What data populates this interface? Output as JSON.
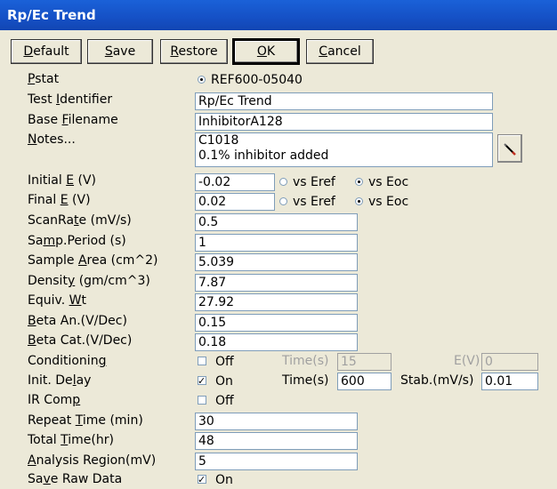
{
  "window": {
    "title": "Rp/Ec Trend"
  },
  "toolbar": {
    "default": {
      "u": "D",
      "rest": "efault"
    },
    "save": {
      "u": "S",
      "rest": "ave"
    },
    "restore": {
      "u": "R",
      "rest": "estore"
    },
    "ok": {
      "u": "O",
      "rest": "K"
    },
    "cancel": {
      "u": "C",
      "rest": "ancel"
    }
  },
  "pstat": {
    "pre": "",
    "u": "P",
    "post": "stat",
    "value": "REF600-05040"
  },
  "test_identifier": {
    "pre": "Test ",
    "u": "I",
    "post": "dentifier",
    "value": "Rp/Ec Trend"
  },
  "base_filename": {
    "pre": "Base ",
    "u": "F",
    "post": "ilename",
    "value": "InhibitorA128"
  },
  "notes": {
    "pre": "",
    "u": "N",
    "post": "otes...",
    "line1": "C1018",
    "line2": "0.1% inhibitor added"
  },
  "initial_e": {
    "pre": "Initial ",
    "u": "E",
    "post": " (V)",
    "value": "-0.02",
    "opt1": "vs Eref",
    "opt2": "vs Eoc"
  },
  "final_e": {
    "pre": "Final ",
    "u": "E",
    "post": " (V)",
    "value": "0.02",
    "opt1": "vs Eref",
    "opt2": "vs Eoc"
  },
  "scan_rate": {
    "pre": "ScanRa",
    "u": "t",
    "post": "e (mV/s)",
    "value": "0.5"
  },
  "samp_period": {
    "pre": "Sa",
    "u": "m",
    "post": "p.Period (s)",
    "value": "1"
  },
  "sample_area": {
    "pre": "Sample ",
    "u": "A",
    "post": "rea (cm^2)",
    "value": "5.039"
  },
  "density": {
    "pre": "Densit",
    "u": "y",
    "post": " (gm/cm^3)",
    "value": "7.87"
  },
  "equiv_wt": {
    "pre": "Equiv. ",
    "u": "W",
    "post": "t",
    "value": "27.92"
  },
  "beta_an": {
    "pre": "",
    "u": "B",
    "post": "eta An.(V/Dec)",
    "value": "0.15"
  },
  "beta_cat": {
    "pre": "",
    "u": "B",
    "post": "eta Cat.(V/Dec)",
    "value": "0.18"
  },
  "conditioning": {
    "pre": "Conditionin",
    "u": "g",
    "post": "",
    "check": "Off",
    "time_label": "Time(s)",
    "time_value": "15",
    "e_label": "E(V)",
    "e_value": "0"
  },
  "init_delay": {
    "pre": "Init. De",
    "u": "l",
    "post": "ay",
    "check": "On",
    "time_label": "Time(s)",
    "time_value": "600",
    "stab_label": "Stab.(mV/s)",
    "stab_value": "0.01"
  },
  "ir_comp": {
    "pre": "IR Com",
    "u": "p",
    "post": "",
    "check": "Off"
  },
  "repeat_time": {
    "pre": "Repeat ",
    "u": "T",
    "post": "ime (min)",
    "value": "30"
  },
  "total_time": {
    "pre": "Total ",
    "u": "T",
    "post": "ime(hr)",
    "value": "48"
  },
  "analysis_region": {
    "pre": "",
    "u": "A",
    "post": "nalysis Region(mV)",
    "value": "5"
  },
  "save_raw": {
    "pre": "Sa",
    "u": "v",
    "post": "e Raw Data",
    "check": "On"
  }
}
